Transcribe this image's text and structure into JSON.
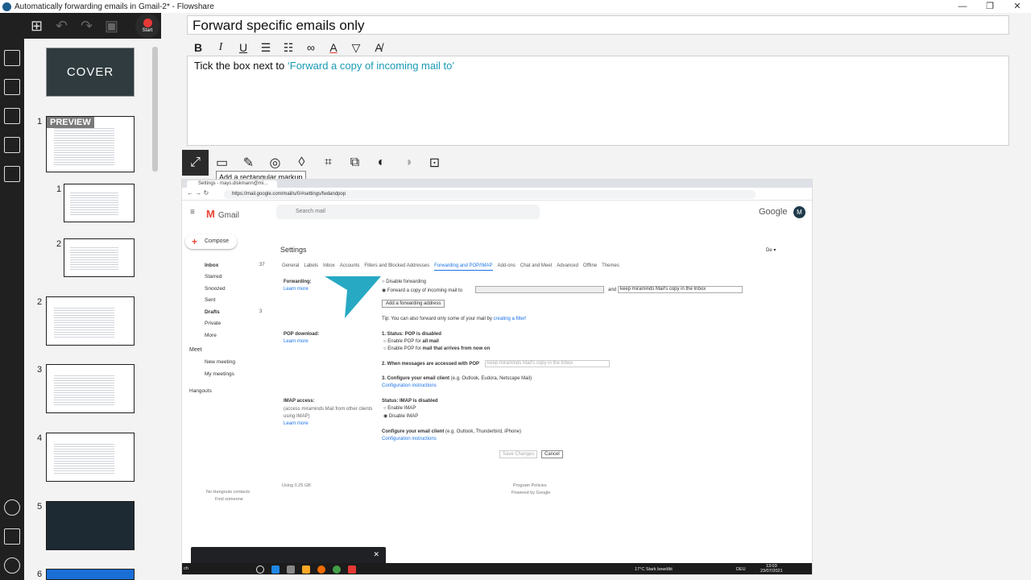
{
  "window": {
    "title": "Automatically forwarding emails in Gmail-2* - Flowshare",
    "minimize": "—",
    "maximize": "❐",
    "close": "✕"
  },
  "toolbar": {
    "start_label": "Start"
  },
  "thumbnails": {
    "cover_label": "COVER",
    "preview_label": "PREVIEW",
    "numbers": [
      "1",
      "1",
      "2",
      "2",
      "3",
      "4",
      "5",
      "6"
    ]
  },
  "step": {
    "title": "Forward specific emails only",
    "description_prefix": "Tick the box next to ",
    "description_highlight": "‘Forward a copy of incoming mail to’"
  },
  "format_tools": {
    "bold": "B",
    "italic": "I",
    "underline": "U"
  },
  "image_tools": {
    "tooltip": "Add a rectangular markup"
  },
  "screenshot": {
    "tab_title": "Settings - mays.diskmann@mi...",
    "url": "https://mail.google.com/mail/u/0/#settings/fwdandpop",
    "gmail_label": "Gmail",
    "search_placeholder": "Search mail",
    "google_word": "Google",
    "avatar_letter": "M",
    "compose": "Compose",
    "nav": [
      {
        "label": "Inbox",
        "count": "37"
      },
      {
        "label": "Starred",
        "count": ""
      },
      {
        "label": "Snoozed",
        "count": ""
      },
      {
        "label": "Sent",
        "count": ""
      },
      {
        "label": "Drafts",
        "count": "3"
      },
      {
        "label": "Private",
        "count": ""
      },
      {
        "label": "More",
        "count": ""
      }
    ],
    "meet_heading": "Meet",
    "new_meeting": "New meeting",
    "my_meetings": "My meetings",
    "hangouts_heading": "Hangouts",
    "no_contacts": "No Hangouts contacts",
    "find_someone": "Find someone",
    "settings_title": "Settings",
    "lang": "De ▾",
    "tabs": [
      "General",
      "Labels",
      "Inbox",
      "Accounts",
      "Filters and Blocked Addresses",
      "Forwarding and POP/IMAP",
      "Add-ons",
      "Chat and Meet",
      "Advanced",
      "Offline",
      "Themes"
    ],
    "forwarding_label": "Forwarding:",
    "learn_more": "Learn more",
    "disable_forwarding": "Disable forwarding",
    "forward_copy": "Forward a copy of incoming mail to",
    "and_label": "and",
    "keep_copy": "keep miraminds Mail's copy in the Inbox",
    "add_forwarding": "Add a forwarding address",
    "tip": "Tip: You can also forward only some of your mail by",
    "create_filter": "creating a filter!",
    "pop_label": "POP download:",
    "pop_status": "1. Status: POP is disabled",
    "pop_enable_all_prefix": "Enable POP for ",
    "pop_enable_all_bold": "all mail",
    "pop_enable_now_prefix": "Enable POP for ",
    "pop_enable_now_bold": "mail that arrives from now on",
    "pop_when": "2. When messages are accessed with POP",
    "pop_when_select": "keep miraminds Mail's copy in the Inbox",
    "pop_configure": "3. Configure your email client",
    "pop_configure_hint": "(e.g. Outlook, Eudora, Netscape Mail)",
    "config_instructions": "Configuration instructions",
    "imap_label": "IMAP access:",
    "imap_sub": "(access miraminds Mail from other clients using IMAP)",
    "imap_status": "Status: IMAP is disabled",
    "enable_imap": "Enable IMAP",
    "disable_imap": "Disable IMAP",
    "imap_configure": "Configure your email client",
    "imap_configure_hint": "(e.g. Outlook, Thunderbird, iPhone)",
    "save_changes": "Save Changes",
    "cancel": "Cancel",
    "usage": "Using 0.25 GB",
    "program_policies": "Program Policies",
    "powered_by": "Powered by Google",
    "toast_close": "✕",
    "taskbar_search": "ch",
    "weather": "17°C Stark bewölkt",
    "locale": "DEU",
    "clock": "13:03",
    "date": "23/07/2021"
  },
  "colors": {
    "accent": "#1a9bb5",
    "markup_arrow": "#27a9c4",
    "rail": "#202020"
  }
}
